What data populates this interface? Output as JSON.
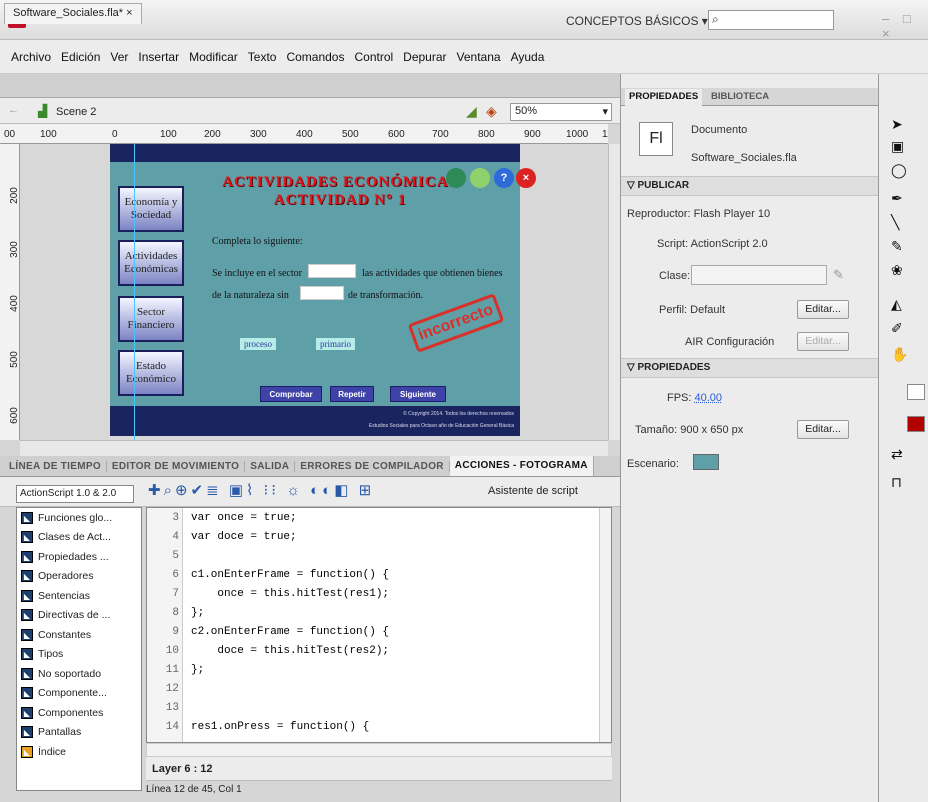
{
  "app": {
    "logo": "Fl",
    "workspace": "CONCEPTOS BÁSICOS ▾",
    "search_placeholder": "",
    "window_controls": "– □ ×"
  },
  "menu": [
    "Archivo",
    "Edición",
    "Ver",
    "Insertar",
    "Modificar",
    "Texto",
    "Comandos",
    "Control",
    "Depurar",
    "Ventana",
    "Ayuda"
  ],
  "document_tab": {
    "label": "Software_Sociales.fla*",
    "close": "×"
  },
  "scene": {
    "label": "Scene 2",
    "zoom": "50%"
  },
  "ruler": {
    "h": [
      "00",
      "100",
      "0",
      "100",
      "200",
      "300",
      "400",
      "500",
      "600",
      "700",
      "800",
      "900",
      "1000",
      "11"
    ],
    "v": [
      "200",
      "300",
      "400",
      "500",
      "600"
    ]
  },
  "stage": {
    "title1": "ACTIVIDADES ECONÓMICAS",
    "title2": "ACTIVIDAD N° 1",
    "nav": [
      "Economía y Sociedad",
      "Actividades Económicas",
      "Sector Financiero",
      "Estado Económico"
    ],
    "instruction": "Completa lo siguiente:",
    "line1a": "Se incluye en el sector",
    "line1b": "las actividades que obtienen bienes",
    "line2a": "de la naturaleza sin",
    "line2b": "de transformación.",
    "word1": "proceso",
    "word2": "primario",
    "stamp": "incorrecto",
    "buttons": [
      "Comprobar",
      "Repetir",
      "Siguiente"
    ],
    "footer1": "© Copyright 2014. Todos los derechos reservados",
    "footer2": "Estudios Sociales para Octavo año de Educación General Básica"
  },
  "panel_tabs": [
    "LÍNEA DE TIEMPO",
    "EDITOR DE MOVIMIENTO",
    "SALIDA",
    "ERRORES DE COMPILADOR",
    "ACCIONES - FOTOGRAMA"
  ],
  "actions": {
    "as_version": "ActionScript 1.0 & 2.0",
    "script_assistant": "Asistente de script",
    "books": [
      "Funciones glo...",
      "Clases de Act...",
      "Propiedades ...",
      "Operadores",
      "Sentencias",
      "Directivas de ...",
      "Constantes",
      "Tipos",
      "No soportado",
      "Componente...",
      "Componentes",
      "Pantallas",
      "Índice"
    ],
    "code": [
      {
        "n": "3",
        "t": "var once = true;"
      },
      {
        "n": "4",
        "t": "var doce = true;"
      },
      {
        "n": "5",
        "t": ""
      },
      {
        "n": "6",
        "t": "c1.onEnterFrame = function() {"
      },
      {
        "n": "7",
        "t": "    once = this.hitTest(res1);"
      },
      {
        "n": "8",
        "t": "};"
      },
      {
        "n": "9",
        "t": "c2.onEnterFrame = function() {"
      },
      {
        "n": "10",
        "t": "    doce = this.hitTest(res2);"
      },
      {
        "n": "11",
        "t": "};"
      },
      {
        "n": "12",
        "t": ""
      },
      {
        "n": "13",
        "t": ""
      },
      {
        "n": "14",
        "t": "res1.onPress = function() {"
      }
    ],
    "layer": "Layer 6 : 12",
    "status": "Línea 12 de 45, Col 1"
  },
  "properties": {
    "tabs": [
      "PROPIEDADES",
      "BIBLIOTECA"
    ],
    "doc_icon": "Fl",
    "doc_type": "Documento",
    "doc_name": "Software_Sociales.fla",
    "publish_header": "PUBLICAR",
    "player": "Reproductor: Flash Player 10",
    "script": "Script: ActionScript 2.0",
    "class_label": "Clase:",
    "profile": "Perfil: Default",
    "edit": "Editar...",
    "air": "AIR Configuración",
    "props_header": "PROPIEDADES",
    "fps_label": "FPS:",
    "fps_value": "40.00",
    "size": "Tamaño: 900 x 650 px",
    "stage_label": "Escenario:",
    "stage_color": "#5f9fa8"
  }
}
